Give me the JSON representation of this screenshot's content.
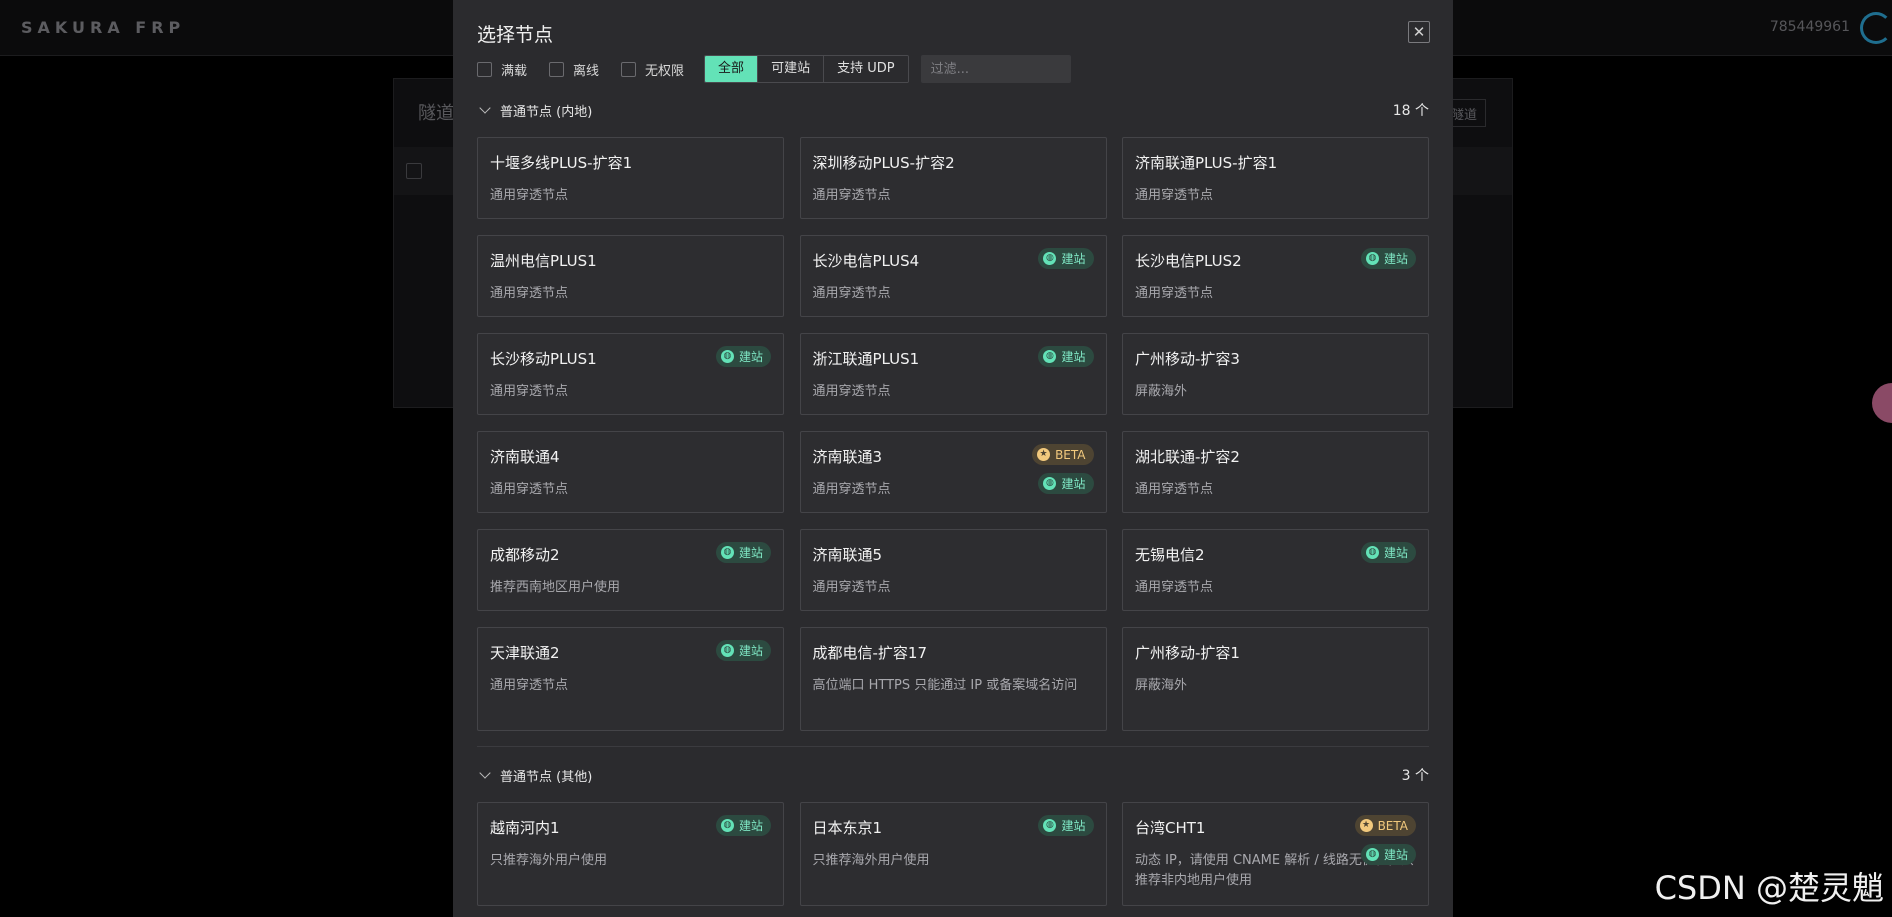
{
  "app": {
    "brand": "SAKURA FRP",
    "user_id": "785449961",
    "bg_title": "隧道",
    "bg_button": "隧道"
  },
  "modal": {
    "title": "选择节点",
    "close_glyph": "✕",
    "filters": {
      "checks": [
        "满载",
        "离线",
        "无权限"
      ],
      "segments": [
        "全部",
        "可建站",
        "支持 UDP"
      ],
      "active_segment": "全部",
      "placeholder": "过滤..."
    }
  },
  "groups": [
    {
      "title": "普通节点 (内地)",
      "count": "18 个",
      "nodes": [
        {
          "name": "十堰多线PLUS-扩容1",
          "desc": "通用穿透节点",
          "tags": []
        },
        {
          "name": "深圳移动PLUS-扩容2",
          "desc": "通用穿透节点",
          "tags": []
        },
        {
          "name": "济南联通PLUS-扩容1",
          "desc": "通用穿透节点",
          "tags": []
        },
        {
          "name": "温州电信PLUS1",
          "desc": "通用穿透节点",
          "tags": []
        },
        {
          "name": "长沙电信PLUS4",
          "desc": "通用穿透节点",
          "tags": [
            "site"
          ]
        },
        {
          "name": "长沙电信PLUS2",
          "desc": "通用穿透节点",
          "tags": [
            "site"
          ]
        },
        {
          "name": "长沙移动PLUS1",
          "desc": "通用穿透节点",
          "tags": [
            "site"
          ]
        },
        {
          "name": "浙江联通PLUS1",
          "desc": "通用穿透节点",
          "tags": [
            "site"
          ]
        },
        {
          "name": "广州移动-扩容3",
          "desc": "屏蔽海外",
          "tags": []
        },
        {
          "name": "济南联通4",
          "desc": "通用穿透节点",
          "tags": []
        },
        {
          "name": "济南联通3",
          "desc": "通用穿透节点",
          "tags": [
            "beta",
            "site"
          ]
        },
        {
          "name": "湖北联通-扩容2",
          "desc": "通用穿透节点",
          "tags": []
        },
        {
          "name": "成都移动2",
          "desc": "推荐西南地区用户使用",
          "tags": [
            "site"
          ]
        },
        {
          "name": "济南联通5",
          "desc": "通用穿透节点",
          "tags": []
        },
        {
          "name": "无锡电信2",
          "desc": "通用穿透节点",
          "tags": [
            "site"
          ]
        },
        {
          "name": "天津联通2",
          "desc": "通用穿透节点",
          "tags": [
            "site"
          ]
        },
        {
          "name": "成都电信-扩容17",
          "desc": "高位端口 HTTPS 只能通过 IP 或备案域名访问",
          "tags": []
        },
        {
          "name": "广州移动-扩容1",
          "desc": "屏蔽海外",
          "tags": []
        }
      ]
    },
    {
      "title": "普通节点 (其他)",
      "count": "3 个",
      "nodes": [
        {
          "name": "越南河内1",
          "desc": "只推荐海外用户使用",
          "tags": [
            "site"
          ]
        },
        {
          "name": "日本东京1",
          "desc": "只推荐海外用户使用",
          "tags": [
            "site"
          ]
        },
        {
          "name": "台湾CHT1",
          "desc": "动态 IP，请使用 CNAME 解析 / 线路无优化，只推荐非内地用户使用",
          "tags": [
            "beta",
            "site"
          ]
        }
      ]
    }
  ],
  "tag_labels": {
    "site": "建站",
    "beta": "BETA"
  },
  "tag_icons": {
    "site": "globe-icon",
    "beta": "star-icon"
  },
  "watermark": "CSDN @楚灵魈"
}
